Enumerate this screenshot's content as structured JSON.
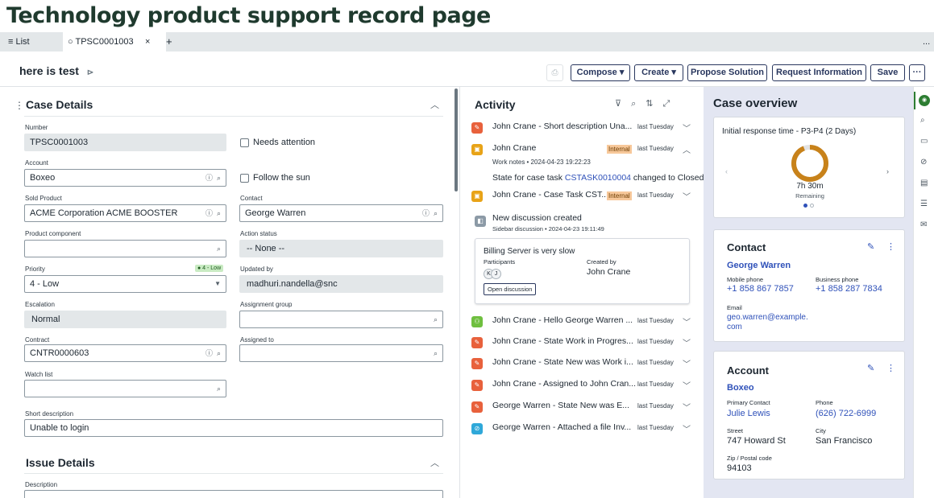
{
  "page_title": "Technology product support record page",
  "tabs": {
    "list_label": "≡ List",
    "record_tab": "○ TPSC0001003",
    "close": "×",
    "add": "+",
    "more": "..."
  },
  "header": {
    "record_title": "here is test",
    "compose": "Compose ▾",
    "create": "Create ▾",
    "propose": "Propose Solution",
    "request": "Request Information",
    "save": "Save",
    "more": "···"
  },
  "case_details": {
    "title": "Case Details",
    "number_label": "Number",
    "number": "TPSC0001003",
    "needs_attention": "Needs attention",
    "account_label": "Account",
    "account": "Boxeo",
    "follow_sun": "Follow the sun",
    "sold_product_label": "Sold Product",
    "sold_product": "ACME Corporation ACME BOOSTER",
    "contact_label": "Contact",
    "contact": "George Warren",
    "product_component_label": "Product component",
    "action_status_label": "Action status",
    "action_status": "-- None --",
    "priority_label": "Priority",
    "priority_badge": "● 4 - Low",
    "priority": "4 - Low",
    "updated_by_label": "Updated by",
    "updated_by": "madhuri.nandella@snc",
    "escalation_label": "Escalation",
    "escalation": "Normal",
    "assignment_group_label": "Assignment group",
    "contract_label": "Contract",
    "contract": "CNTR0000603",
    "assigned_to_label": "Assigned to",
    "watch_list_label": "Watch list",
    "short_desc_label": "Short description",
    "short_desc": "Unable to login"
  },
  "issue_details": {
    "title": "Issue Details",
    "description_label": "Description"
  },
  "activity": {
    "title": "Activity",
    "items": [
      {
        "text": "John Crane - Short description Una...",
        "date": "last Tuesday",
        "color": "#e8613c",
        "icon": "✎"
      },
      {
        "text": "John Crane - Case Task CST...",
        "date": "last Tuesday",
        "color": "#e8a317",
        "icon": "🔒"
      },
      {
        "text": "John Crane - Hello George Warren ...",
        "date": "last Tuesday",
        "color": "#6fbf3f",
        "icon": "👥"
      },
      {
        "text": "John Crane - State Work in Progres...",
        "date": "last Tuesday",
        "color": "#e8613c",
        "icon": "✎"
      },
      {
        "text": "John Crane - State New was Work i...",
        "date": "last Tuesday",
        "color": "#e8613c",
        "icon": "✎"
      },
      {
        "text": "John Crane - Assigned to John Cran...",
        "date": "last Tuesday",
        "color": "#e8613c",
        "icon": "✎"
      },
      {
        "text": "George Warren - State New was E...",
        "date": "last Tuesday",
        "color": "#e8613c",
        "icon": "✎"
      },
      {
        "text": "George Warren - Attached a file Inv...",
        "date": "last Tuesday",
        "color": "#2fa8d9",
        "icon": "🔗"
      }
    ],
    "expanded": {
      "author": "John Crane",
      "internal": "Internal",
      "date": "last Tuesday",
      "worknotes": "Work notes • 2024-04-23 19:22:23",
      "state_text": "State for case task",
      "task_link": "CSTASK0010004",
      "changed": "changed to Closed"
    },
    "internal2": "Internal",
    "discussion": {
      "title": "New discussion created",
      "sub": "Sidebar discussion • 2024-04-23 19:11:49",
      "card_title": "Billing Server is very slow",
      "participants_label": "Participants",
      "created_by_label": "Created by",
      "created_by": "John Crane",
      "p1": "K",
      "p2": "J",
      "open": "Open discussion"
    }
  },
  "overview": {
    "title": "Case overview",
    "response_title": "Initial response time - P3-P4 (2 Days)",
    "time": "7h 30m",
    "remaining": "Remaining",
    "donut_fraction": 0.94
  },
  "contact_card": {
    "title": "Contact",
    "name": "George Warren",
    "mobile_label": "Mobile phone",
    "mobile": "+1 858 867 7857",
    "business_label": "Business phone",
    "business": "+1 858 287 7834",
    "email_label": "Email",
    "email1": "geo.warren@example.",
    "email2": "com"
  },
  "account_card": {
    "title": "Account",
    "name": "Boxeo",
    "primary_label": "Primary Contact",
    "primary": "Julie Lewis",
    "phone_label": "Phone",
    "phone": "(626) 722-6999",
    "street_label": "Street",
    "street": "747 Howard St",
    "city_label": "City",
    "city": "San Francisco",
    "zip_label": "Zip / Postal code",
    "zip": "94103"
  }
}
